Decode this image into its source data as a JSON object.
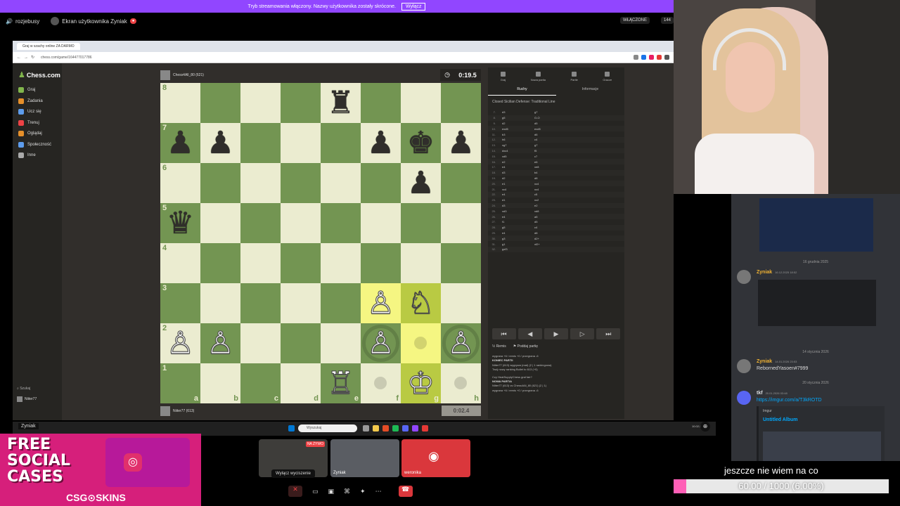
{
  "banner": {
    "text": "Tryb streamowania włączony. Nazwy użytkownika zostały skrócone.",
    "button": "Wyłącz"
  },
  "discord_top": {
    "server": "rozjebusy",
    "screen_label": "Ekran użytkownika Zyniak",
    "live": "WŁĄCZONE",
    "viewer_count": "144"
  },
  "browser": {
    "tab_title": "Graj w szachy online ZA DARMO",
    "url": "chess.com/game/164477017786"
  },
  "chess_sidebar": {
    "logo": "Chess.com",
    "items": [
      {
        "label": "Graj",
        "color": "#81b64c"
      },
      {
        "label": "Zadania",
        "color": "#e58f2a"
      },
      {
        "label": "Ucz się",
        "color": "#5d9cec"
      },
      {
        "label": "Trenuj",
        "color": "#ed4245"
      },
      {
        "label": "Oglądaj",
        "color": "#e58f2a"
      },
      {
        "label": "Społeczność",
        "color": "#5d9cec"
      },
      {
        "label": "Inne",
        "color": "#aaa"
      }
    ],
    "search": "Szukaj",
    "username": "Niiter77"
  },
  "players": {
    "top": {
      "name": "Chess4All_80 (621)",
      "clock": "0:19.5"
    },
    "bottom": {
      "name": "Niiter77 (613)",
      "clock": "0:02.4"
    }
  },
  "board": {
    "ranks": [
      "8",
      "7",
      "6",
      "5",
      "4",
      "3",
      "2",
      "1"
    ],
    "files": [
      "a",
      "b",
      "c",
      "d",
      "e",
      "f",
      "g",
      "h"
    ],
    "pieces": {
      "e8": "♜",
      "a7": "♟",
      "b7": "♟",
      "f7": "♟",
      "g7": "♚",
      "h7": "♟",
      "g6": "♟",
      "a5": "♛",
      "f3": "♙",
      "g3": "♘",
      "a2": "♙",
      "b2": "♙",
      "f2": "♙",
      "h2": "♙",
      "e1": "♖",
      "g1": "♔"
    },
    "white_pieces": [
      "f3",
      "g3",
      "a2",
      "b2",
      "f2",
      "h2",
      "e1",
      "g1"
    ],
    "highlighted": [
      "f3",
      "g3",
      "g2",
      "g1"
    ],
    "hint_dots": [
      "g2",
      "f1",
      "h1"
    ],
    "capture_rings": [
      "f2",
      "h2"
    ]
  },
  "panel": {
    "tabs": [
      "Graj",
      "Nowa partia",
      "Partie",
      "Gracze"
    ],
    "sub_tabs": [
      "Ruchy",
      "Informacje"
    ],
    "opening": "Closed Sicilian Defense: Traditional Line",
    "moves": [
      [
        "7.",
        "d3",
        "g7"
      ],
      [
        "8.",
        "g5",
        "O-O"
      ],
      [
        "9.",
        "d2",
        "d5"
      ],
      [
        "10.",
        "exd5",
        "exd5"
      ],
      [
        "11.",
        "b3",
        "d6"
      ],
      [
        "12.",
        "h6",
        "c4"
      ],
      [
        "13.",
        "xg7",
        "g7"
      ],
      [
        "14.",
        "dxc4",
        "f5"
      ],
      [
        "15.",
        "xd5",
        "c7"
      ],
      [
        "16.",
        "e2",
        "e6"
      ],
      [
        "17.",
        "e4",
        "xe8"
      ],
      [
        "18.",
        "d3",
        "b4"
      ],
      [
        "19.",
        "d2",
        "d8"
      ],
      [
        "20.",
        "e1",
        "xc4"
      ],
      [
        "21.",
        "xc4",
        "xc4"
      ],
      [
        "22.",
        "e4",
        "c5"
      ],
      [
        "23.",
        "d1",
        "xc2"
      ],
      [
        "24.",
        "d3",
        "e2"
      ],
      [
        "25.",
        "xd3",
        "xd8"
      ],
      [
        "26.",
        "e4",
        "a5"
      ],
      [
        "27.",
        "f1",
        "d5"
      ],
      [
        "28.",
        "g5",
        "c4"
      ],
      [
        "29.",
        "e4",
        "d8"
      ],
      [
        "30.",
        "g3",
        "d2+"
      ],
      [
        "31.",
        "g1",
        "xf2+"
      ],
      [
        "32.",
        "gxf3",
        ""
      ]
    ],
    "controls": [
      "⏮",
      "◀",
      "▶",
      "▷",
      "⏭"
    ],
    "actions": [
      "Remis",
      "Poddaj partię"
    ],
    "log_lines": [
      "wygrana +6 / remis +0 / przegrana -6",
      "KONIEC PARTII",
      "Niiter77 (613) wygrywa (mat) (2 | 1 rankingowa)",
      "Twój nowy ranking Bullet to 613 (+0)",
      "Czy HeatSupplyChess grał fair?",
      "NOWA PARTIA",
      "Niiter77 (613) vs Chess4All_80 (621) (2 | 1)",
      "wygrana +6 / remis +0 / przegrana -6"
    ],
    "chat_placeholder": "Wyślij wiadomość..."
  },
  "taskbar": {
    "search": "Wyszukaj",
    "clock": "10.02.2026"
  },
  "stream_thumbs": {
    "live_badge": "NA ŻYWO",
    "user2": "Zyniak",
    "user3": "weronika",
    "tooltip": "Wyłącz wyciszenie"
  },
  "ad": {
    "line1": "FREE",
    "line2": "SOCIAL",
    "line3": "CASES",
    "brand": "CSG⊙SKINS"
  },
  "zyniak_tag": "Zyniak",
  "discord_chat": {
    "date1": "16 grudnia 2025",
    "msg1": {
      "name": "Zyniak",
      "time": "16.12.2025 18:52"
    },
    "date2": "14 stycznia 2026",
    "msg2": {
      "name": "Zyniak",
      "time": "14.01.2026 23:53",
      "text": "RebornedYasoen#7999"
    },
    "date3": "20 stycznia 2026",
    "msg3": {
      "name": "tkf",
      "time": "20.01.2026 03:48",
      "text": "https://imgur.com/a/T3kROTD",
      "embed_site": "Imgur",
      "embed_title": "Untitled Album"
    }
  },
  "goal": {
    "text": "jeszcze nie wiem na co",
    "label": "60.00 / 1000 (6.00%)",
    "progress": 0.06
  }
}
